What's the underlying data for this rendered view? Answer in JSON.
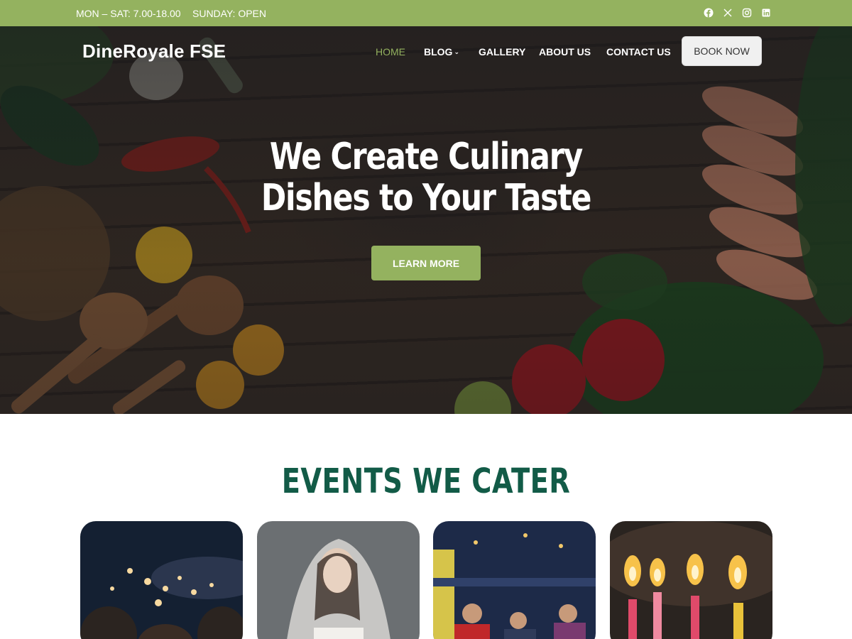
{
  "topbar": {
    "hours": "MON – SAT: 7.00-18.00",
    "sunday": "SUNDAY: OPEN",
    "social": [
      "facebook-icon",
      "x-icon",
      "instagram-icon",
      "linkedin-icon"
    ],
    "background": "#94b25f"
  },
  "header": {
    "logo": "DineRoyale FSE",
    "nav": {
      "home": "HOME",
      "blog": "BLOG",
      "gallery": "GALLERY",
      "about": "ABOUT US",
      "contact": "CONTACT US"
    },
    "book_button": "BOOK NOW"
  },
  "hero": {
    "title_line1": "We Create Culinary",
    "title_line2": "Dishes to Your Taste",
    "button": "LEARN MORE"
  },
  "events": {
    "title": "EVENTS WE CATER",
    "title_color": "#125b47"
  },
  "colors": {
    "accent": "#94b25f",
    "heading": "#125b47"
  }
}
